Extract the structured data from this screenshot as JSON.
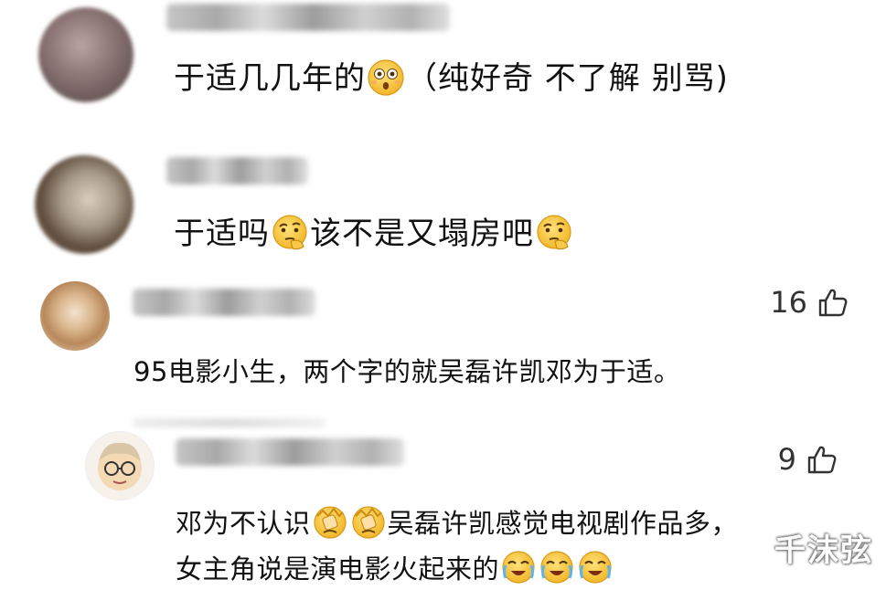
{
  "comments": [
    {
      "text_before": "于适几几年的",
      "text_after": "（纯好奇 不了解 别骂)",
      "emoji": "astonished-face-icon"
    },
    {
      "text_part1": "于适吗",
      "text_part2": "该不是又塌房吧",
      "emoji": "thinking-face-icon"
    },
    {
      "likes": "16",
      "text": "95电影小生，两个字的就吴磊许凯邓为于适。"
    },
    {
      "likes": "9",
      "line1_before": "邓为不认识",
      "line1_after": "吴磊许凯感觉电视剧作品多，",
      "line2": "女主角说是演电影火起来的",
      "emojis_line1": [
        "facepalm-icon",
        "facepalm-icon"
      ],
      "emojis_line2": [
        "crying-face-icon",
        "crying-face-icon",
        "crying-face-icon"
      ]
    }
  ],
  "watermark": "千沫弦",
  "colors": {
    "background": "#ffffff",
    "text": "#111111",
    "emoji_yellow": "#f6c544"
  }
}
